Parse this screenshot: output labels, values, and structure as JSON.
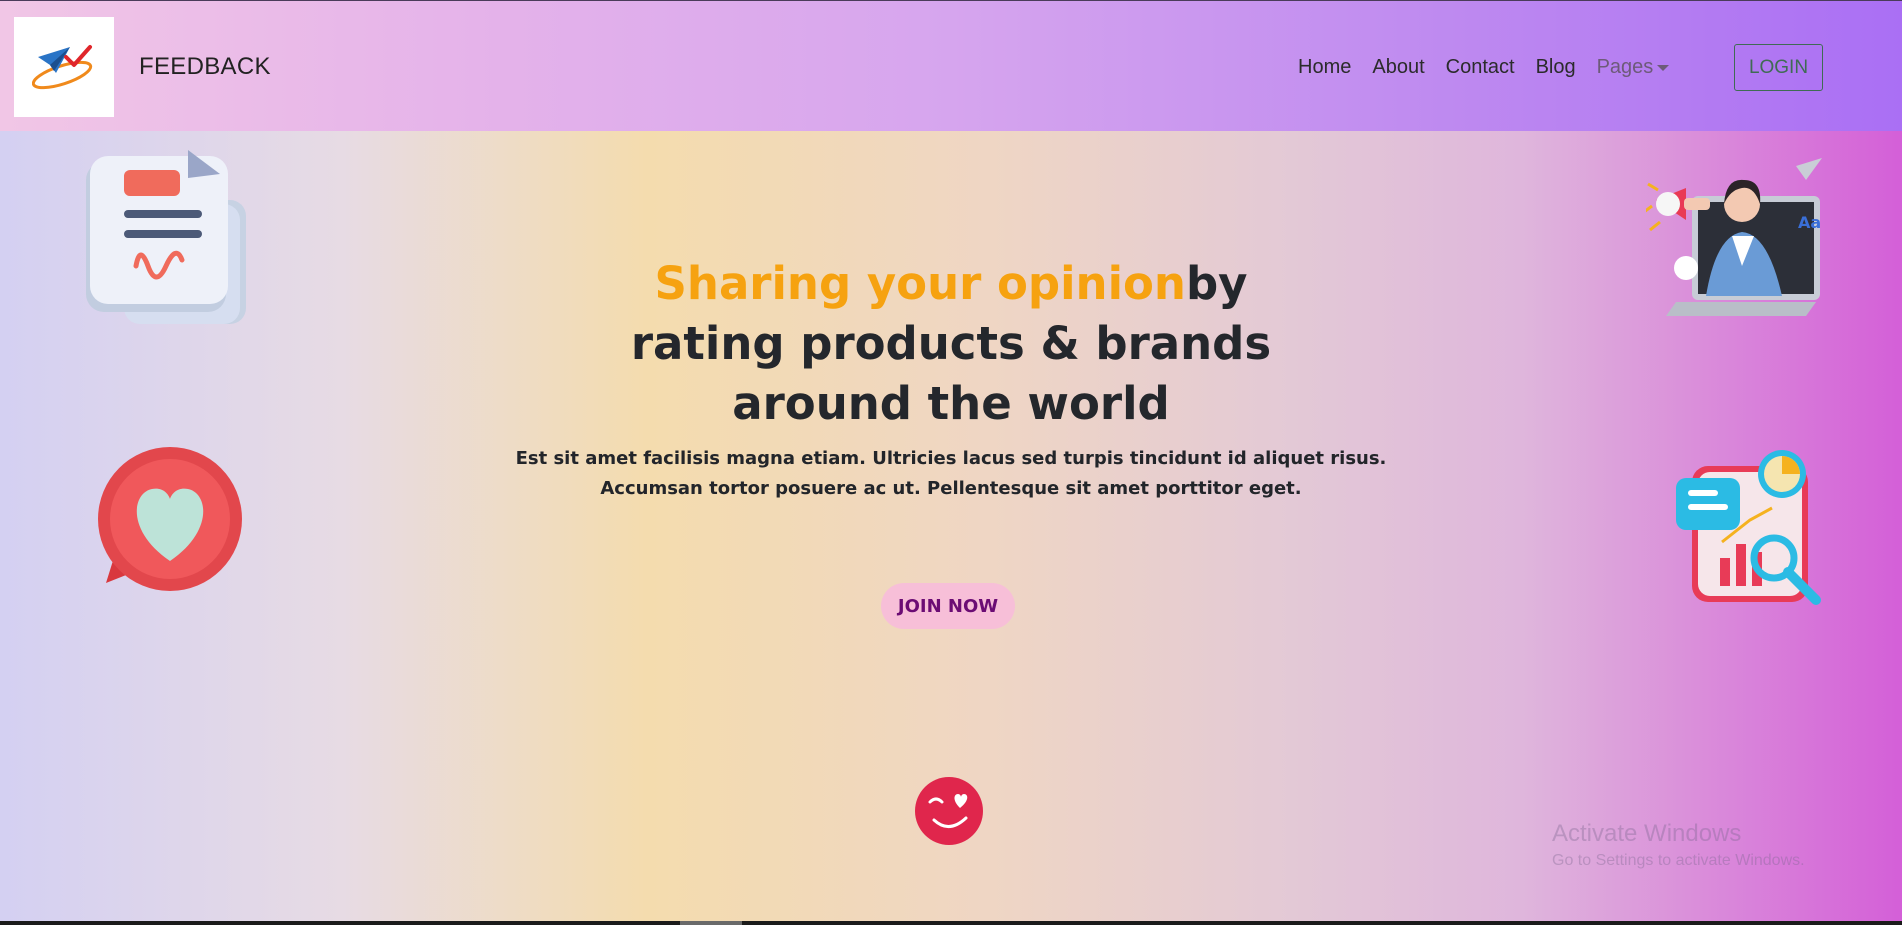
{
  "navbar": {
    "brand": "FEEDBACK",
    "links": [
      "Home",
      "About",
      "Contact",
      "Blog"
    ],
    "dropdown_label": "Pages",
    "login_label": "LOGIN"
  },
  "hero": {
    "title_highlight": "Sharing your opinion",
    "title_rest_1": "by",
    "title_line_2": "rating products & brands",
    "title_line_3": "around the world",
    "subtitle_line_1": "Est sit amet facilisis magna etiam. Ultricies lacus sed turpis tincidunt id aliquet risus.",
    "subtitle_line_2": "Accumsan tortor posuere ac ut. Pellentesque sit amet porttitor eget.",
    "cta_label": "JOIN NOW"
  },
  "watermark": {
    "line_1": "Activate Windows",
    "line_2": "Go to Settings to activate Windows."
  },
  "icons": {
    "logo": "paper-plane-check-logo-icon",
    "document": "document-icon",
    "heart_bubble": "heart-chat-bubble-icon",
    "megaphone_laptop": "woman-megaphone-laptop-icon",
    "analytics": "analytics-chart-magnifier-icon",
    "wink_emoji": "wink-heart-emoji-icon"
  },
  "colors": {
    "highlight": "#f6a210",
    "cta_bg": "#f7bfd8",
    "cta_text": "#6b0c74",
    "heading": "#24272c"
  }
}
